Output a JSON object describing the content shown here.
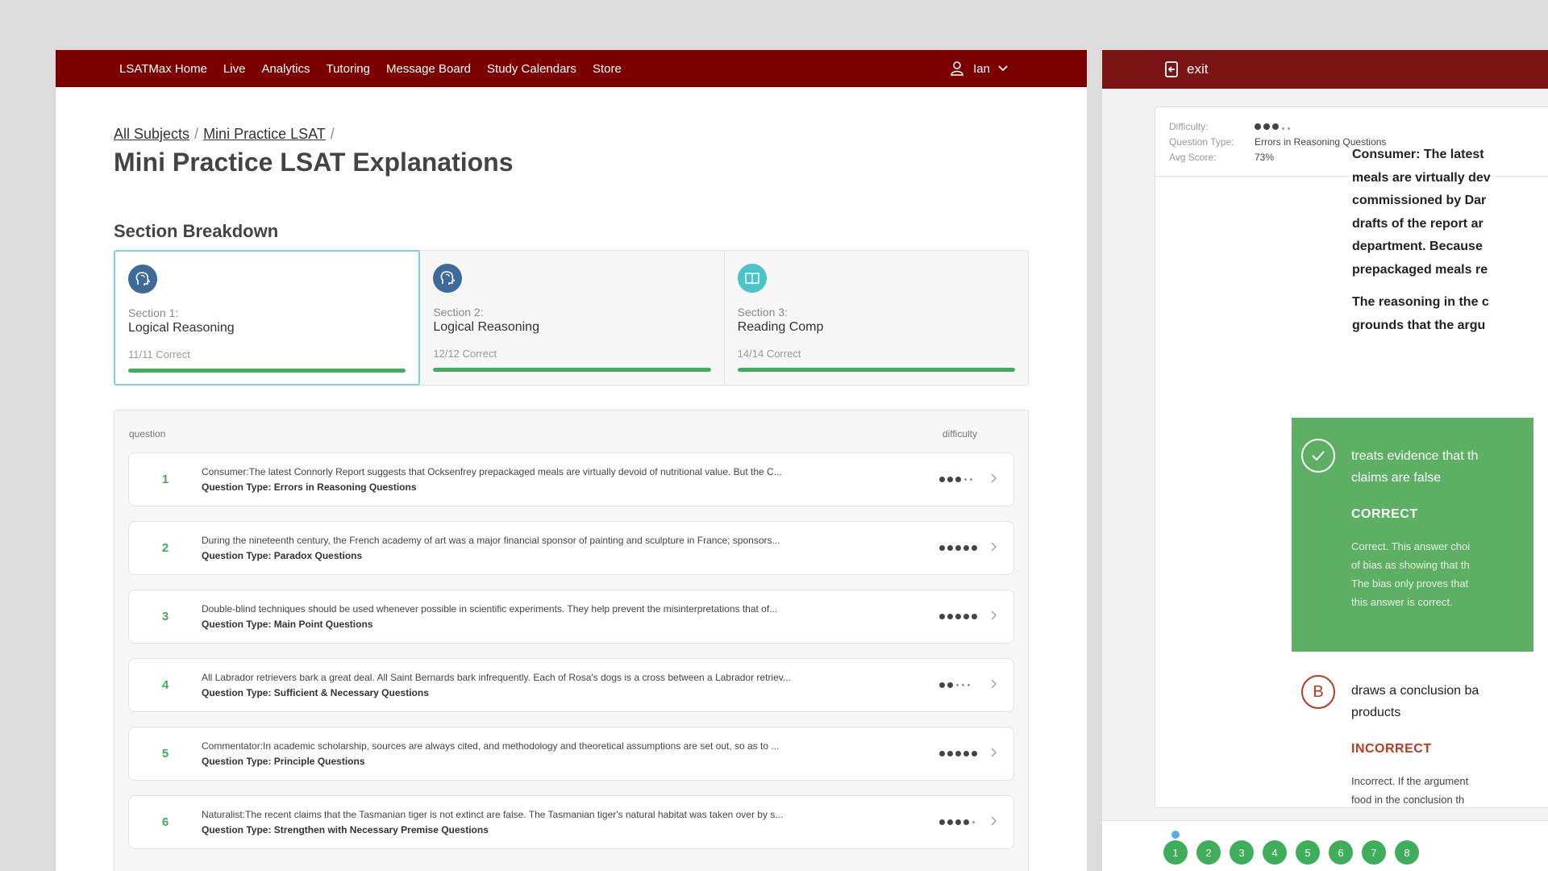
{
  "nav": {
    "links": [
      "LSATMax Home",
      "Live",
      "Analytics",
      "Tutoring",
      "Message Board",
      "Study Calendars",
      "Store"
    ],
    "user_name": "Ian"
  },
  "breadcrumb": [
    "All Subjects",
    "Mini Practice LSAT"
  ],
  "page_title": "Mini Practice LSAT Explanations",
  "section_breakdown_title": "Section Breakdown",
  "sections": [
    {
      "sub": "Section 1:",
      "name": "Logical Reasoning",
      "score": "11/11 Correct",
      "progress": 1.0,
      "icon": "head-profile-icon"
    },
    {
      "sub": "Section 2:",
      "name": "Logical Reasoning",
      "score": "12/12 Correct",
      "progress": 1.0,
      "icon": "head-profile-icon"
    },
    {
      "sub": "Section 3:",
      "name": "Reading Comp",
      "score": "14/14 Correct",
      "progress": 1.0,
      "icon": "book-icon"
    }
  ],
  "table": {
    "col_question": "question",
    "col_difficulty": "difficulty",
    "type_prefix": "Question Type:",
    "rows": [
      {
        "num": "1",
        "text": "Consumer:The latest Connorly Report suggests that Ocksenfrey prepackaged meals are virtually devoid of nutritional value. But the C...",
        "type": "Errors in Reasoning Questions",
        "difficulty": 3
      },
      {
        "num": "2",
        "text": "During the nineteenth century, the French academy of art was a major financial sponsor of painting and sculpture in France; sponsors...",
        "type": "Paradox Questions",
        "difficulty": 5
      },
      {
        "num": "3",
        "text": "Double-blind techniques should be used whenever possible in scientific experiments. They help prevent the misinterpretations that of...",
        "type": "Main Point Questions",
        "difficulty": 5
      },
      {
        "num": "4",
        "text": "All Labrador retrievers bark a great deal. All Saint Bernards bark infrequently. Each of Rosa's dogs is a cross between a Labrador retriev...",
        "type": "Sufficient & Necessary Questions",
        "difficulty": 2
      },
      {
        "num": "5",
        "text": "Commentator:In academic scholarship, sources are always cited, and methodology and theoretical assumptions are set out, so as to ...",
        "type": "Principle Questions",
        "difficulty": 5
      },
      {
        "num": "6",
        "text": "Naturalist:The recent claims that the Tasmanian tiger is not extinct are false. The Tasmanian tiger's natural habitat was taken over by s...",
        "type": "Strengthen with Necessary Premise Questions",
        "difficulty": 4
      }
    ]
  },
  "detail": {
    "exit_label": "exit",
    "meta": {
      "difficulty_label": "Difficulty:",
      "difficulty": 3,
      "type_label": "Question Type:",
      "type_value": "Errors in Reasoning Questions",
      "avg_label": "Avg Score:",
      "avg_value": "73%"
    },
    "passage_lines": [
      "Consumer:  The latest",
      "meals are virtually dev",
      "commissioned by Dar",
      "drafts of the report ar",
      "department. Because",
      "prepackaged meals re"
    ],
    "question_lines": [
      "The reasoning in the c",
      "grounds that the argu"
    ],
    "answer_a": {
      "lines": [
        "treats evidence that th",
        "claims are false"
      ],
      "status": "CORRECT",
      "explanation": [
        "Correct. This answer choi",
        "of bias as showing that th",
        "The bias only proves that",
        "this answer is correct."
      ]
    },
    "answer_b": {
      "letter": "B",
      "lines": [
        "draws a conclusion ba",
        "products"
      ],
      "status": "INCORRECT",
      "explanation": [
        "Incorrect. If the argument",
        "food in the conclusion th"
      ]
    },
    "pager": [
      "1",
      "2",
      "3",
      "4",
      "5",
      "6",
      "7",
      "8"
    ],
    "colors": {
      "correct": "#5caf63",
      "incorrect": "#c0391b",
      "header": "#7b0000"
    }
  }
}
